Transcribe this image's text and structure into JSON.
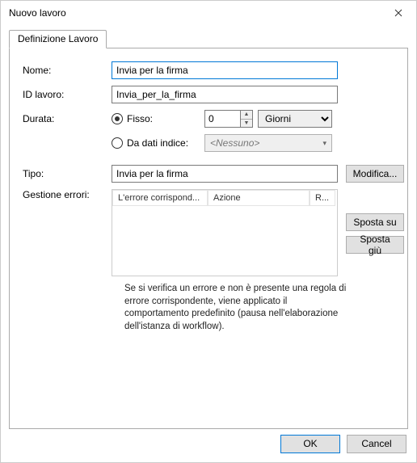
{
  "window": {
    "title": "Nuovo lavoro"
  },
  "tabs": {
    "definition": "Definizione Lavoro"
  },
  "labels": {
    "nome": "Nome:",
    "id": "ID lavoro:",
    "durata": "Durata:",
    "tipo": "Tipo:",
    "gestione_errori": "Gestione errori:"
  },
  "fields": {
    "nome_value": "Invia per la firma",
    "id_value": "Invia_per_la_firma",
    "tipo_value": "Invia per la firma"
  },
  "durata": {
    "fisso_label": "Fisso:",
    "da_dati_label": "Da dati indice:",
    "fisso_value": "0",
    "units_value": "Giorni",
    "indice_placeholder": "<Nessuno>"
  },
  "errors": {
    "col_match": "L'errore corrispond...",
    "col_action": "Azione",
    "col_r": "R...",
    "note": "Se si verifica un errore e non è presente una regola di errore corrispondente, viene applicato il comportamento predefinito (pausa nell'elaborazione dell'istanza di workflow)."
  },
  "buttons": {
    "modifica": "Modifica...",
    "sposta_su": "Sposta su",
    "sposta_giu": "Sposta giù",
    "ok": "OK",
    "cancel": "Cancel"
  }
}
